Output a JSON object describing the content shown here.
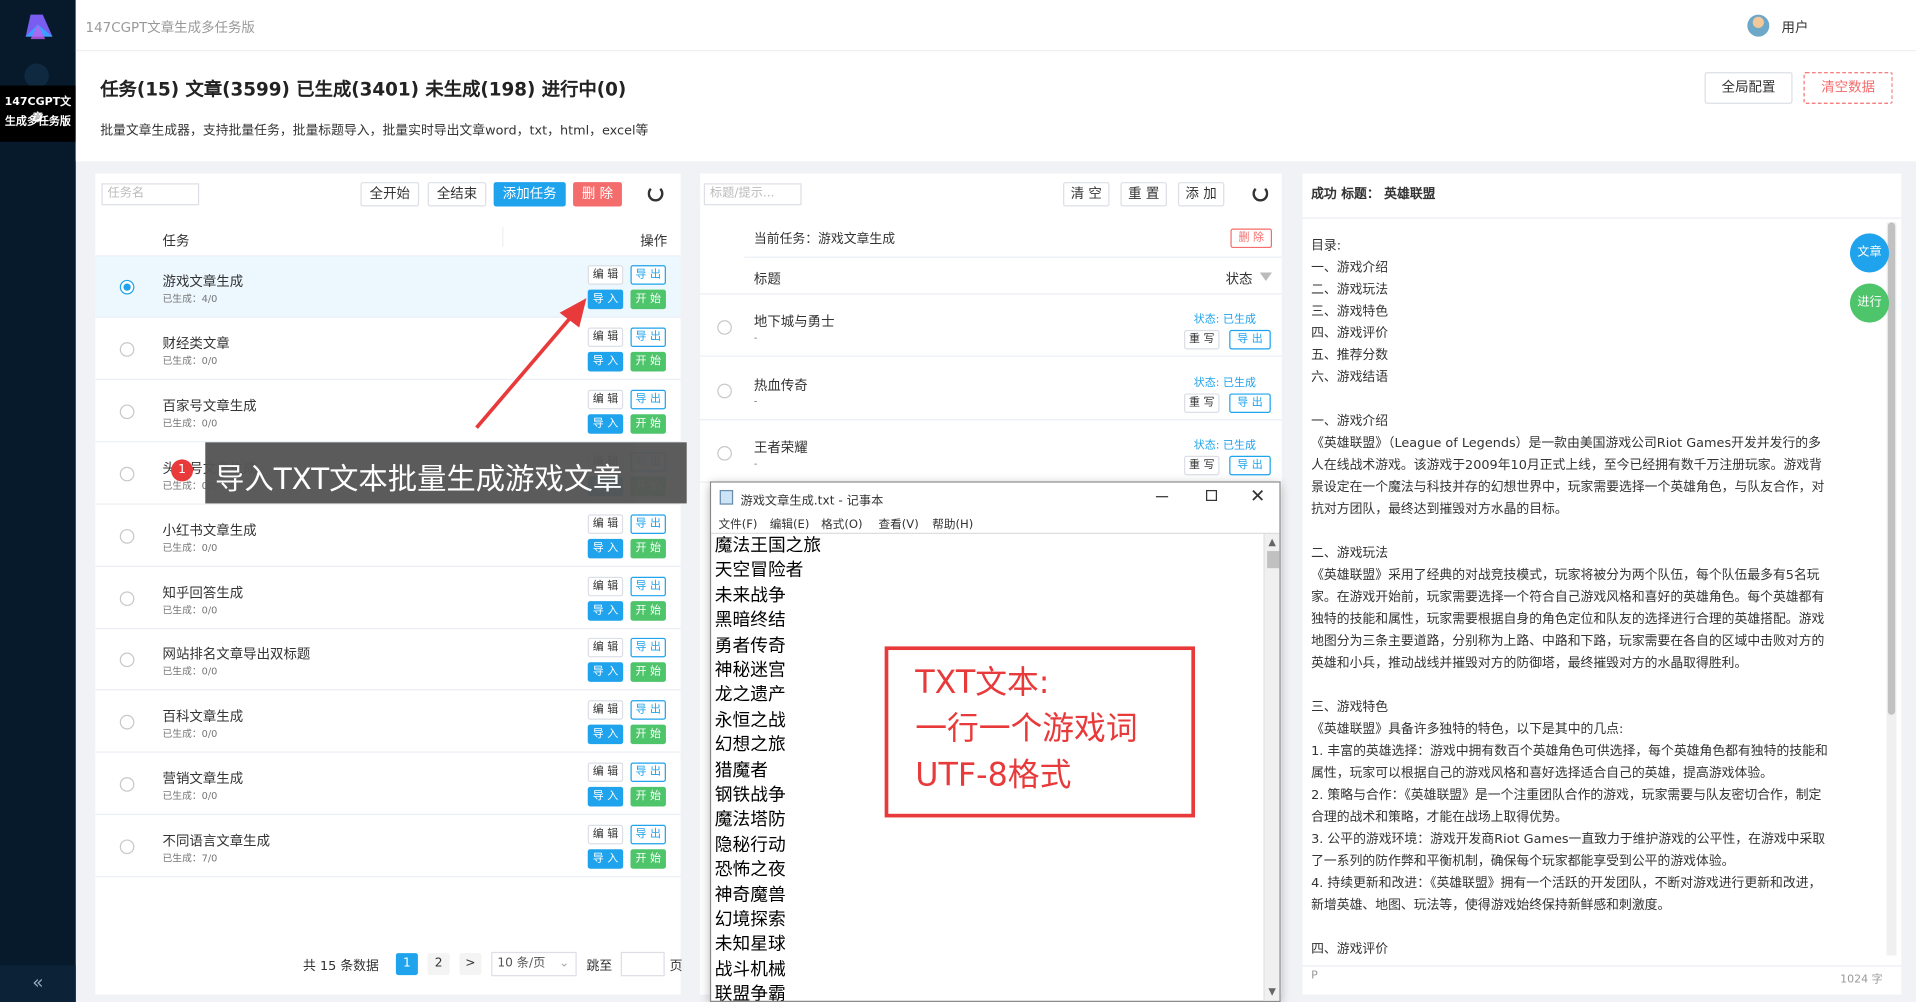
{
  "app": {
    "title": "147CGPT文章生成多任务版",
    "sidebar_title_l1": "147CGPT文章",
    "sidebar_title_l2": "生成多任务版",
    "user": "用户",
    "collapse": "«"
  },
  "header": {
    "stats": "任务(15) 文章(3599) 已生成(3401) 未生成(198) 进行中(0)",
    "subtitle": "批量文章生成器，支持批量任务，批量标题导入，批量实时导出文章word，txt，html，excel等",
    "global_config": "全局配置",
    "clear_data": "清空数据"
  },
  "task_panel": {
    "search_placeholder": "任务名",
    "start_all": "全开始",
    "end_all": "全结束",
    "add_task": "添加任务",
    "delete": "删 除",
    "col_task": "任务",
    "col_action": "操作",
    "btn_edit": "编 辑",
    "btn_export": "导 出",
    "btn_import": "导 入",
    "btn_start": "开 始",
    "tasks": [
      {
        "name": "游戏文章生成",
        "sub": "已生成：4/0"
      },
      {
        "name": "财经类文章",
        "sub": "已生成：0/0"
      },
      {
        "name": "百家号文章生成",
        "sub": "已生成：0/0"
      },
      {
        "name": "头条号文章生成",
        "sub": "已生成：0/0"
      },
      {
        "name": "小红书文章生成",
        "sub": "已生成：0/0"
      },
      {
        "name": "知乎回答生成",
        "sub": "已生成：0/0"
      },
      {
        "name": "网站排名文章导出双标题",
        "sub": "已生成：0/0"
      },
      {
        "name": "百科文章生成",
        "sub": "已生成：0/0"
      },
      {
        "name": "营销文章生成",
        "sub": "已生成：0/0"
      },
      {
        "name": "不同语言文章生成",
        "sub": "已生成：7/0"
      }
    ],
    "pagination": {
      "total": "共 15 条数据",
      "page1": "1",
      "page2": "2",
      "next": ">",
      "per_page": "10 条/页",
      "jump": "跳至",
      "page_unit": "页"
    }
  },
  "title_panel": {
    "search_placeholder": "标题/提示...",
    "clear": "清 空",
    "reset": "重 置",
    "add": "添 加",
    "current_task": "当前任务：游戏文章生成",
    "delete": "删 除",
    "col_title": "标题",
    "col_status": "状态",
    "btn_rewrite": "重 写",
    "btn_export": "导 出",
    "items": [
      {
        "title": "地下城与勇士",
        "sub": "-",
        "status_label": "状态:",
        "status": "已生成"
      },
      {
        "title": "热血传奇",
        "sub": "-",
        "status_label": "状态:",
        "status": "已生成"
      },
      {
        "title": "王者荣耀",
        "sub": "-",
        "status_label": "状态:",
        "status": "已生成"
      }
    ]
  },
  "article_panel": {
    "header": "成功 标题： 英雄联盟",
    "btn_article": "文章",
    "btn_progress": "进行",
    "footer_left": "P",
    "footer_right": "1024 字",
    "lines": [
      "目录:",
      "一、游戏介绍",
      "二、游戏玩法",
      "三、游戏特色",
      "四、游戏评价",
      "五、推荐分数",
      "六、游戏结语",
      "",
      "一、游戏介绍",
      "《英雄联盟》（League of Legends）是一款由美国游戏公司Riot Games开发并发行的多",
      "人在线战术游戏。该游戏于2009年10月正式上线，至今已经拥有数千万注册玩家。游戏背",
      "景设定在一个魔法与科技并存的幻想世界中，玩家需要选择一个英雄角色，与队友合作，对",
      "抗对方团队，最终达到摧毁对方水晶的目标。",
      "",
      "二、游戏玩法",
      "《英雄联盟》采用了经典的对战竞技模式，玩家将被分为两个队伍，每个队伍最多有5名玩",
      "家。在游戏开始前，玩家需要选择一个符合自己游戏风格和喜好的英雄角色。每个英雄都有",
      "独特的技能和属性，玩家需要根据自身的角色定位和队友的选择进行合理的英雄搭配。游戏",
      "地图分为三条主要道路，分别称为上路、中路和下路，玩家需要在各自的区域中击败对方的",
      "英雄和小兵，推动战线并摧毁对方的防御塔，最终摧毁对方的水晶取得胜利。",
      "",
      "三、游戏特色",
      "《英雄联盟》具备许多独特的特色，以下是其中的几点:",
      "1. 丰富的英雄选择：游戏中拥有数百个英雄角色可供选择，每个英雄角色都有独特的技能和",
      "属性，玩家可以根据自己的游戏风格和喜好选择适合自己的英雄，提高游戏体验。",
      "2. 策略与合作：《英雄联盟》是一个注重团队合作的游戏，玩家需要与队友密切合作，制定",
      "合理的战术和策略，才能在战场上取得优势。",
      "3. 公平的游戏环境：游戏开发商Riot Games一直致力于维护游戏的公平性，在游戏中采取",
      "了一系列的防作弊和平衡机制，确保每个玩家都能享受到公平的游戏体验。",
      "4. 持续更新和改进：《英雄联盟》拥有一个活跃的开发团队，不断对游戏进行更新和改进，",
      "新增英雄、地图、玩法等，使得游戏始终保持新鲜感和刺激度。",
      "",
      "四、游戏评价"
    ]
  },
  "notepad": {
    "title": "游戏文章生成.txt - 记事本",
    "menu": [
      "文件(F)",
      "编辑(E)",
      "格式(O)",
      "查看(V)",
      "帮助(H)"
    ],
    "lines": [
      "魔法王国之旅",
      "天空冒险者",
      "未来战争",
      "黑暗终结",
      "勇者传奇",
      "神秘迷宫",
      "龙之遗产",
      "永恒之战",
      "幻想之旅",
      "猎魔者",
      "钢铁战争",
      "魔法塔防",
      "隐秘行动",
      "恐怖之夜",
      "神奇魔兽",
      "幻境探索",
      "未知星球",
      "战斗机械",
      "联盟争霸"
    ]
  },
  "annotations": {
    "badge": "1",
    "tooltip": "导入TXT文本批量生成游戏文章",
    "note_l1": "TXT文本:",
    "note_l2": "一行一个游戏词",
    "note_l3": "UTF-8格式"
  },
  "colors": {
    "sidebar": "#061a2c",
    "primary": "#1ea3ec",
    "success": "#4ec46b",
    "danger": "#f56c6c",
    "annotation": "#e83a3a"
  }
}
